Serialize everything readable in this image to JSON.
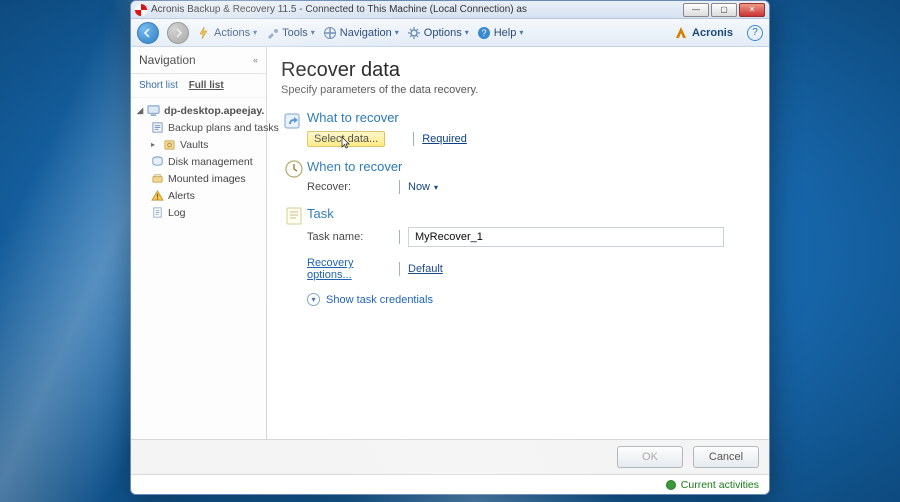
{
  "window": {
    "title": "Acronis Backup & Recovery 11.5 - Connected to This Machine (Local Connection) as"
  },
  "toolbar": {
    "actions": "Actions",
    "tools": "Tools",
    "navigation": "Navigation",
    "options": "Options",
    "help": "Help",
    "brand": "Acronis"
  },
  "sidebar": {
    "header": "Navigation",
    "tabs": {
      "short": "Short list",
      "full": "Full list"
    },
    "root": "dp-desktop.apeejay.stya.com",
    "items": [
      {
        "label": "Backup plans and tasks"
      },
      {
        "label": "Vaults"
      },
      {
        "label": "Disk management"
      },
      {
        "label": "Mounted images"
      },
      {
        "label": "Alerts"
      },
      {
        "label": "Log"
      }
    ]
  },
  "main": {
    "title": "Recover data",
    "subtitle": "Specify parameters of the data recovery.",
    "section_what": "What to recover",
    "select_data": "Select data...",
    "required": "Required",
    "section_when": "When to recover",
    "recover_label": "Recover:",
    "recover_value": "Now",
    "section_task": "Task",
    "taskname_label": "Task name:",
    "taskname_value": "MyRecover_1",
    "recovery_options": "Recovery options...",
    "default": "Default",
    "show_creds": "Show task credentials"
  },
  "footer": {
    "ok": "OK",
    "cancel": "Cancel"
  },
  "status": "Current activities"
}
